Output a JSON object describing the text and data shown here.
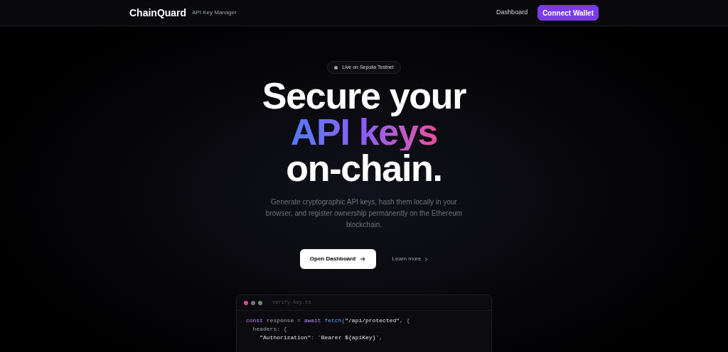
{
  "nav": {
    "brand": "ChainQuard",
    "tagline": "API Key Manager",
    "links": [
      "Dashboard"
    ],
    "cta": "Connect Wallet"
  },
  "hero": {
    "badge": "Live on Sepolia Testnet",
    "title_lines": [
      {
        "text": "Secure your",
        "kind": "plain"
      },
      {
        "text": "API keys",
        "kind": "gradient"
      },
      {
        "text": "on-chain.",
        "kind": "plain"
      }
    ],
    "description": "Generate cryptographic API keys, hash them locally in your browser, and register ownership permanently on the Ethereum blockchain.",
    "primary_button": "Open Dashboard",
    "secondary_link": "Learn more"
  },
  "code_window": {
    "dots": [
      {
        "color": "#e0449a"
      },
      {
        "color": "#777777"
      },
      {
        "color": "#6f8a6f"
      }
    ],
    "filename": "verify-key.ts",
    "lines": [
      [
        {
          "text": "const",
          "kind": "keyword"
        },
        {
          "text": " response = ",
          "kind": "plain"
        },
        {
          "text": "await",
          "kind": "keyword"
        },
        {
          "text": " fetch",
          "kind": "function"
        },
        {
          "text": "(",
          "kind": "plain"
        },
        {
          "text": "\"/api/protected\"",
          "kind": "string"
        },
        {
          "text": ", {",
          "kind": "plain"
        }
      ],
      [
        {
          "text": "  headers: {",
          "kind": "plain"
        }
      ],
      [
        {
          "text": "    \"Authorization\"",
          "kind": "string"
        },
        {
          "text": ": ",
          "kind": "plain"
        },
        {
          "text": "`Bearer ${apiKey}`",
          "kind": "string"
        },
        {
          "text": ",",
          "kind": "plain"
        }
      ]
    ]
  }
}
